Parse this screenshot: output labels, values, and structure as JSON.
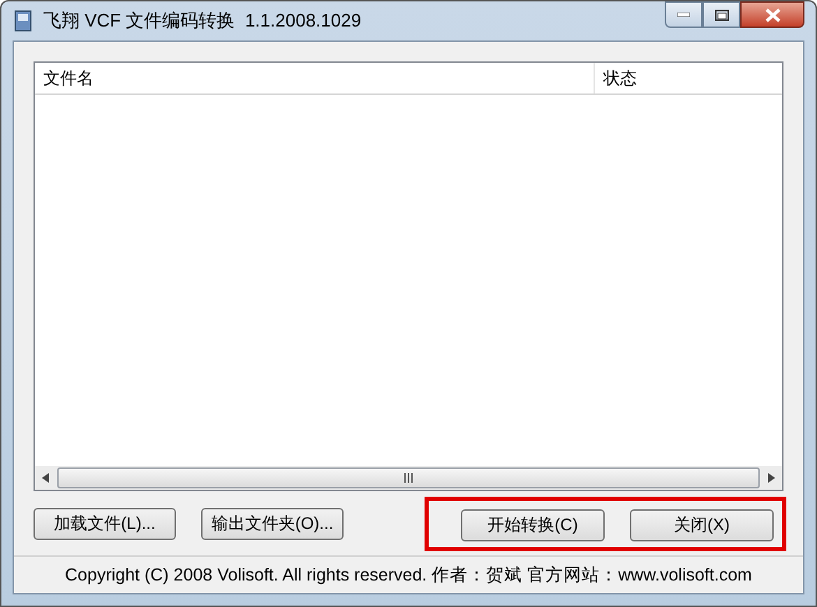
{
  "window": {
    "title": "飞翔 VCF 文件编码转换  1.1.2008.1029"
  },
  "table": {
    "columns": [
      "文件名",
      "状态"
    ]
  },
  "buttons_left": [
    "加载文件(L)...",
    "输出文件夹(O)..."
  ],
  "buttons_right": [
    "开始转换(C)",
    "关闭(X)"
  ],
  "status_bar": "Copyright (C) 2008 Volisoft. All rights reserved.  作者：贺斌  官方网站：www.volisoft.com"
}
